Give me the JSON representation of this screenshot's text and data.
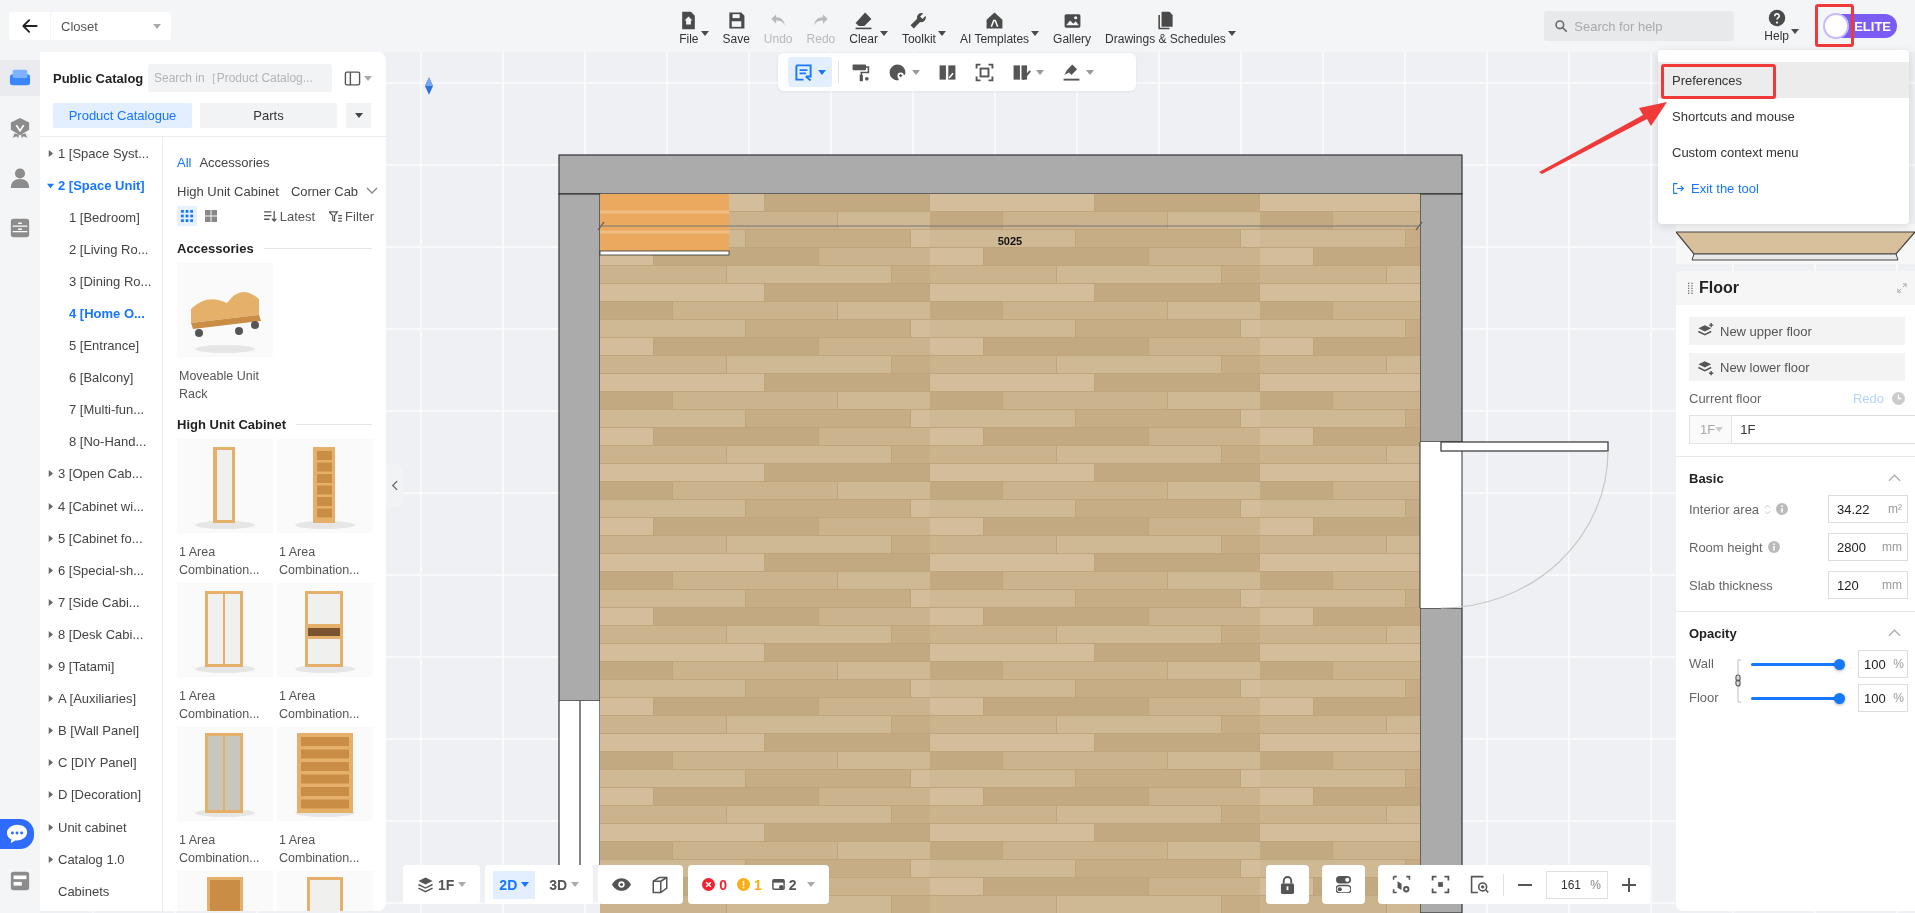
{
  "top_bar": {
    "project": {
      "value": "Closet"
    },
    "tools": [
      {
        "label": "File",
        "disabled": false,
        "menu": true
      },
      {
        "label": "Save",
        "disabled": false,
        "menu": false
      },
      {
        "label": "Undo",
        "disabled": true,
        "menu": false
      },
      {
        "label": "Redo",
        "disabled": true,
        "menu": false
      },
      {
        "label": "Clear",
        "disabled": false,
        "menu": true
      },
      {
        "label": "Toolkit",
        "disabled": false,
        "menu": true
      },
      {
        "label": "AI Templates",
        "disabled": false,
        "menu": true
      },
      {
        "label": "Gallery",
        "disabled": false,
        "menu": false
      },
      {
        "label": "Drawings & Schedules",
        "disabled": false,
        "menu": true
      }
    ],
    "help_search": {
      "placeholder": "Search for help"
    },
    "help": {
      "label": "Help",
      "menu": true
    },
    "account": {
      "badge": "ELITE",
      "highlighted": true
    }
  },
  "sidebar": {
    "tabs": [
      {
        "selected": true
      },
      {
        "selected": false
      },
      {
        "selected": false
      },
      {
        "selected": false
      },
      {
        "selected": false
      }
    ]
  },
  "user_menu": {
    "items": [
      {
        "label": "Preferences",
        "kind": "item",
        "selected": true,
        "highlighted": true
      },
      {
        "label": "Shortcuts and mouse",
        "kind": "item",
        "selected": false,
        "highlighted": false
      },
      {
        "label": "Custom context menu",
        "kind": "item",
        "selected": false,
        "highlighted": false
      },
      {
        "label": "Exit the tool",
        "kind": "link",
        "selected": false,
        "highlighted": false
      }
    ]
  },
  "left_panel": {
    "title": "Public Catalog",
    "search": {
      "placeholder": "Search in［Product Catalog..."
    },
    "tabs": [
      {
        "label": "Product Catalogue",
        "selected": true
      },
      {
        "label": "Parts",
        "selected": false
      }
    ],
    "tree": [
      {
        "label": "1 [Space Syst...",
        "kind": "folder",
        "expanded": false,
        "selected": false
      },
      {
        "label": "2 [Space Unit]",
        "kind": "folder",
        "expanded": true,
        "selected": false,
        "children": [
          {
            "label": "1 [Bedroom]",
            "selected": false
          },
          {
            "label": "2 [Living Ro...",
            "selected": false
          },
          {
            "label": "3 [Dining Ro...",
            "selected": false
          },
          {
            "label": "4 [Home O...",
            "selected": true
          },
          {
            "label": "5 [Entrance]",
            "selected": false
          },
          {
            "label": "6 [Balcony]",
            "selected": false
          },
          {
            "label": "7 [Multi-fun...",
            "selected": false
          },
          {
            "label": "8 [No-Hand...",
            "selected": false
          }
        ]
      },
      {
        "label": "3 [Open Cab...",
        "kind": "folder",
        "expanded": false,
        "selected": false
      },
      {
        "label": "4 [Cabinet wi...",
        "kind": "folder",
        "expanded": false,
        "selected": false
      },
      {
        "label": "5 [Cabinet fo...",
        "kind": "folder",
        "expanded": false,
        "selected": false
      },
      {
        "label": "6 [Special-sh...",
        "kind": "folder",
        "expanded": false,
        "selected": false
      },
      {
        "label": "7 [Side Cabi...",
        "kind": "folder",
        "expanded": false,
        "selected": false
      },
      {
        "label": "8 [Desk Cabi...",
        "kind": "folder",
        "expanded": false,
        "selected": false
      },
      {
        "label": "9 [Tatami]",
        "kind": "folder",
        "expanded": false,
        "selected": false
      },
      {
        "label": "A [Auxiliaries]",
        "kind": "folder",
        "expanded": false,
        "selected": false
      },
      {
        "label": "B [Wall Panel]",
        "kind": "folder",
        "expanded": false,
        "selected": false
      },
      {
        "label": "C [DIY Panel]",
        "kind": "folder",
        "expanded": false,
        "selected": false
      },
      {
        "label": "D [Decoration]",
        "kind": "folder",
        "expanded": false,
        "selected": false
      },
      {
        "label": "Unit cabinet",
        "kind": "folder",
        "expanded": false,
        "selected": false
      },
      {
        "label": "Catalog 1.0",
        "kind": "folder",
        "expanded": false,
        "selected": false
      },
      {
        "label": "Cabinets",
        "kind": "leaf",
        "expanded": false,
        "selected": false
      }
    ],
    "filter_tabs": [
      {
        "label": "All",
        "selected": true
      },
      {
        "label": "Accessories",
        "selected": false
      }
    ],
    "categories": [
      "High Unit Cabinet",
      "Corner Cab"
    ],
    "view_modes": [
      {
        "selected": true
      },
      {
        "selected": false
      }
    ],
    "sort": "Latest",
    "filter": "Filter",
    "sections": [
      {
        "title": "Accessories",
        "products": [
          {
            "name": "Moveable Unit Rack",
            "kind": "picture"
          }
        ]
      },
      {
        "title": "High Unit Cabinet",
        "products": [
          {
            "name": "1 Area Combination...",
            "kind": "picture"
          },
          {
            "name": "1 Area Combination...",
            "kind": "picture"
          },
          {
            "name": "1 Area Combination...",
            "kind": "picture"
          },
          {
            "name": "1 Area Combination...",
            "kind": "picture"
          },
          {
            "name": "1 Area Combination...",
            "kind": "picture"
          },
          {
            "name": "1 Area Combination...",
            "kind": "picture"
          },
          {
            "kind": "picture"
          },
          {
            "kind": "picture"
          }
        ]
      }
    ]
  },
  "floor_plan": {
    "dimension": "5025"
  },
  "canvas_toolbar": {
    "tools": [
      {
        "selected": true,
        "menu": true
      },
      {
        "selected": false,
        "menu": false
      },
      {
        "selected": false,
        "menu": true
      },
      {
        "selected": false,
        "menu": false
      },
      {
        "selected": false,
        "menu": false
      },
      {
        "selected": false,
        "menu": true
      },
      {
        "selected": false,
        "menu": true
      }
    ]
  },
  "floor_panel": {
    "title": "Floor",
    "actions": [
      "New upper floor",
      "New lower floor"
    ],
    "current_floor": {
      "label": "Current floor",
      "redo": {
        "label": "Redo",
        "disabled": true
      },
      "level_select": {
        "value": "1F",
        "disabled": true
      },
      "name": {
        "value": "1F"
      }
    },
    "basic": {
      "title": "Basic",
      "expanded": true,
      "fields": [
        {
          "label": "Interior area",
          "value": "34.22",
          "unit": "m²",
          "sortable": true,
          "info": true
        },
        {
          "label": "Room height",
          "value": "2800",
          "unit": "mm",
          "sortable": false,
          "info": true
        },
        {
          "label": "Slab thickness",
          "value": "120",
          "unit": "mm",
          "sortable": false,
          "info": false
        }
      ]
    },
    "opacity": {
      "title": "Opacity",
      "expanded": true,
      "linked": true,
      "sliders": [
        {
          "label": "Wall",
          "level": 1,
          "value": "100",
          "unit": "%"
        },
        {
          "label": "Floor",
          "level": 1,
          "value": "100",
          "unit": "%"
        }
      ]
    }
  },
  "bottom_bar": {
    "floor": {
      "value": "1F"
    },
    "views": [
      {
        "label": "2D",
        "selected": true
      },
      {
        "label": "3D",
        "selected": false
      }
    ],
    "issues": [
      {
        "kind": "error",
        "count": "0",
        "color": "#f5222d"
      },
      {
        "kind": "warning",
        "count": "1",
        "color": "#faad14"
      },
      {
        "kind": "task",
        "count": "2",
        "color": "#555555"
      }
    ],
    "zoom": {
      "value": "161",
      "unit": "%"
    }
  }
}
